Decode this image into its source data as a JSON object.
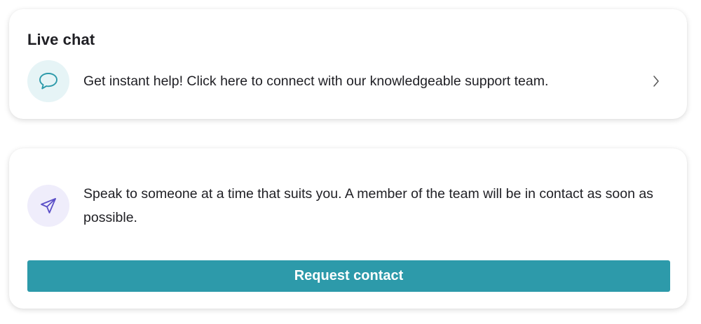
{
  "live_chat": {
    "title": "Live chat",
    "icon": "chat-bubble-icon",
    "description": "Get instant help! Click here to connect with our knowledgeable support team.",
    "chevron_icon": "chevron-right-icon",
    "icon_color": "#2d9aaa",
    "icon_bg": "#e6f4f6"
  },
  "request_contact": {
    "icon": "send-icon",
    "description": "Speak to someone at a time that suits you. A member of the team will be in contact as soon as possible.",
    "button_label": "Request contact",
    "button_color": "#2d9aaa",
    "icon_color": "#5b4fc7",
    "icon_bg": "#efedfb"
  }
}
